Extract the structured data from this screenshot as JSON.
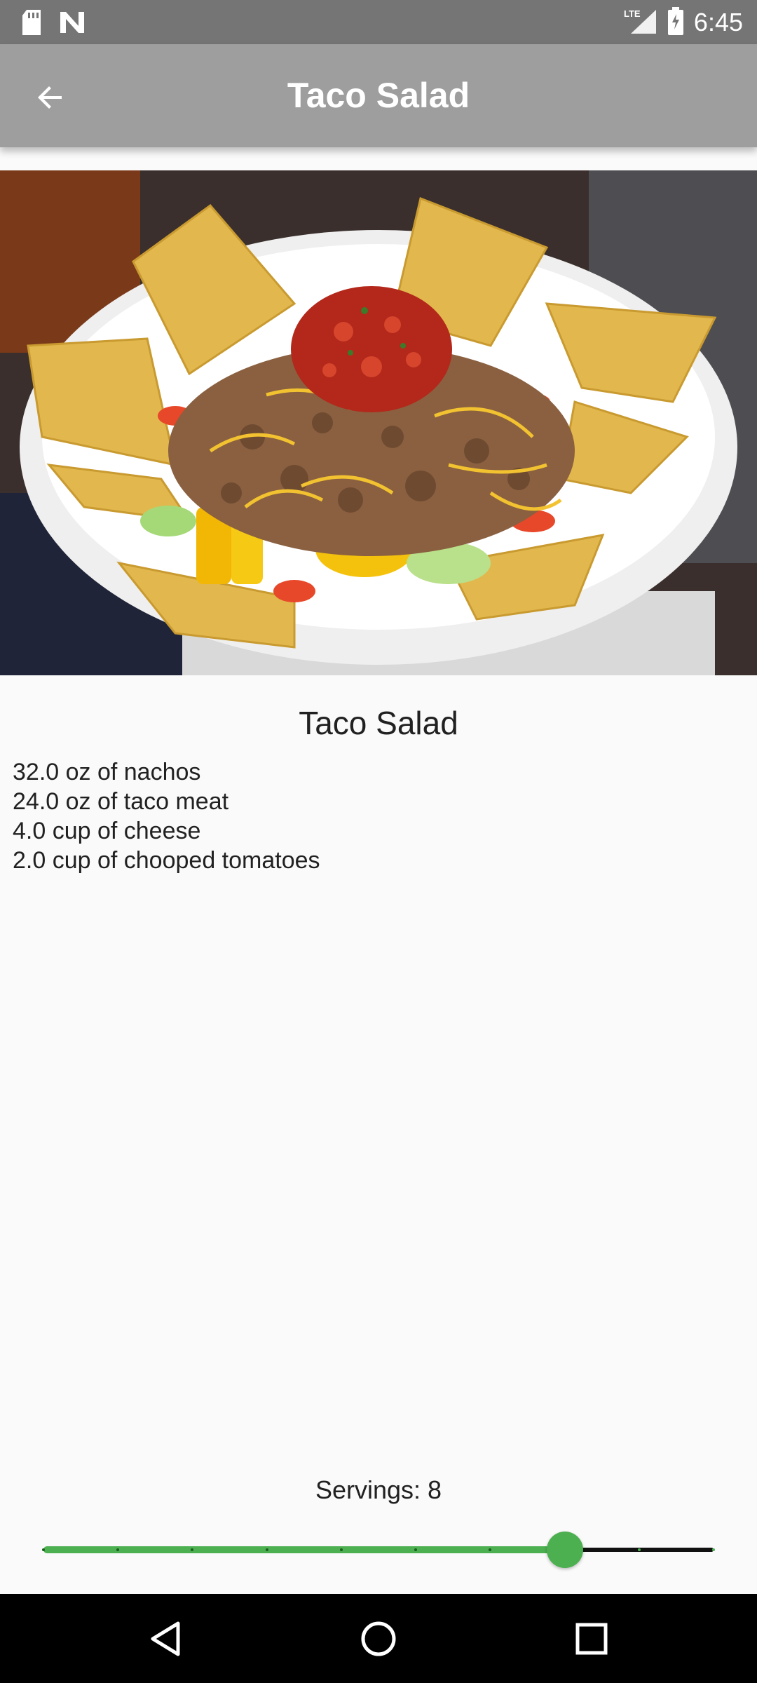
{
  "status_bar": {
    "time": "6:45",
    "network": "LTE",
    "icons": [
      "sd-card-icon",
      "n-logo-icon",
      "lte-signal-icon",
      "battery-icon"
    ]
  },
  "app_bar": {
    "title": "Taco Salad",
    "back_icon": "arrow-back-icon"
  },
  "recipe": {
    "title": "Taco Salad",
    "ingredients": [
      "32.0 oz of nachos",
      "24.0 oz of taco meat",
      "4.0 cup of cheese",
      "2.0 cup of chooped tomatoes"
    ]
  },
  "servings": {
    "label": "Servings: 8",
    "value": 8,
    "min": 1,
    "max": 10,
    "accent_color": "#4caf50"
  },
  "nav_bar": {
    "icons": [
      "back-triangle-icon",
      "home-circle-icon",
      "recents-square-icon"
    ]
  }
}
